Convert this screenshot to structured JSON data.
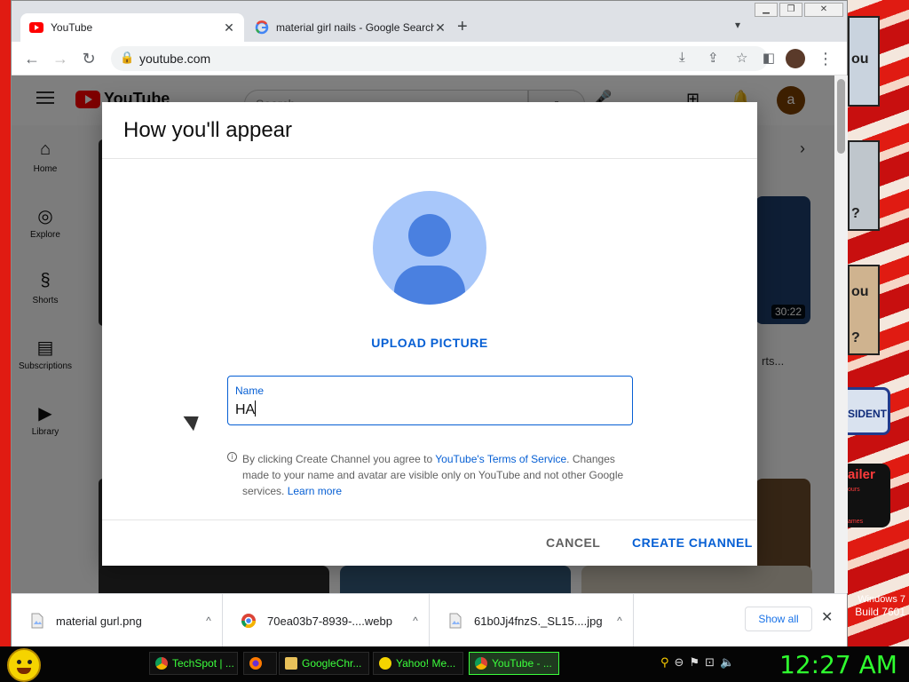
{
  "browser": {
    "tabs": [
      {
        "title": "YouTube",
        "active": true
      },
      {
        "title": "material girl nails - Google Search",
        "active": false
      }
    ],
    "url": "youtube.com"
  },
  "youtube": {
    "search_placeholder": "Search",
    "avatar_letter": "a",
    "sidebar": [
      {
        "icon": "home-icon",
        "label": "Home"
      },
      {
        "icon": "explore-icon",
        "label": "Explore"
      },
      {
        "icon": "shorts-icon",
        "label": "Shorts"
      },
      {
        "icon": "subscriptions-icon",
        "label": "Subscriptions"
      },
      {
        "icon": "library-icon",
        "label": "Library"
      }
    ],
    "durations": [
      "30:22"
    ],
    "snippet": "rts..."
  },
  "dialog": {
    "title": "How you'll appear",
    "upload_label": "UPLOAD PICTURE",
    "name_label": "Name",
    "name_value": "HA",
    "terms_prefix": "By clicking Create Channel you agree to ",
    "terms_link": "YouTube's Terms of Service",
    "terms_suffix": ". Changes made to your name and avatar are visible only on YouTube and not other Google services. ",
    "learn_more": "Learn more",
    "cancel_label": "CANCEL",
    "create_label": "CREATE CHANNEL"
  },
  "downloads": {
    "items": [
      {
        "name": "material gurl.png",
        "icon": "image-file-icon"
      },
      {
        "name": "70ea03b7-8939-....webp",
        "icon": "chrome-icon"
      },
      {
        "name": "61b0Jj4fnzS._SL15....jpg",
        "icon": "image-file-icon"
      }
    ],
    "show_all": "Show all"
  },
  "taskbar": {
    "tasks": [
      {
        "label": "TechSpot | ...",
        "icon": "chrome-icon"
      },
      {
        "label": "",
        "icon": "firefox-icon"
      },
      {
        "label": "GoogleChr...",
        "icon": "folder-icon"
      },
      {
        "label": "Yahoo! Me...",
        "icon": "yahoo-messenger-icon"
      },
      {
        "label": "YouTube - ...",
        "icon": "chrome-icon"
      }
    ],
    "clock": "12:27 AM"
  },
  "os": {
    "line1": "Windows 7",
    "line2": "Build 7601"
  },
  "wallpaper": {
    "texts": [
      "ou",
      "?",
      "ou",
      "?",
      "SIDENT",
      "ailer",
      "ours",
      "ames"
    ]
  },
  "colors": {
    "accent": "#065fd4",
    "desktop": "#e01b12",
    "clock": "#2fff2f"
  }
}
